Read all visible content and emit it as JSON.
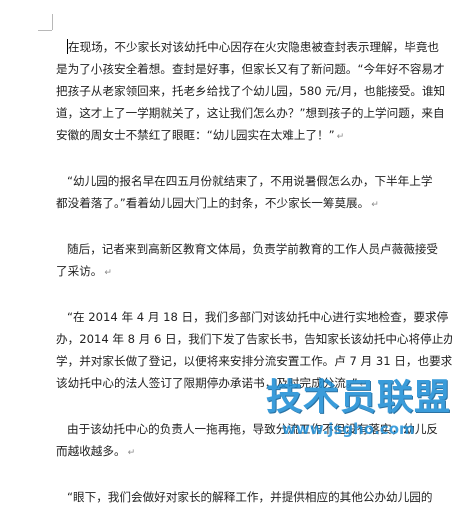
{
  "document": {
    "paragraphs": [
      {
        "lines": [
          "在现场，不少家长对该幼托中心因存在火灾隐患被查封表示理解，毕竟也",
          "是为了小孩安全着想。查封是好事，但家长又有了新问题。“今年好不容易才",
          "把孩子从老家领回来，托老乡给找了个幼儿园，580 元/月，也能接受。谁知",
          "道，这才上了一学期就关了，这让我们怎么办？”想到孩子的上学问题，来自",
          "安徽的周女士不禁红了眼眶：“幼儿园实在太难上了！”"
        ]
      },
      {
        "lines": [
          "“幼儿园的报名早在四五月份就结束了，不用说暑假怎么办，下半年上学",
          "都没着落了。”看着幼儿园大门上的封条，不少家长一筹莫展。"
        ]
      },
      {
        "lines": [
          "随后，记者来到高新区教育文体局，负责学前教育的工作人员卢薇薇接受",
          "了采访。"
        ]
      },
      {
        "lines": [
          "“在 2014 年 4 月 18 日，我们多部门对该幼托中心进行实地检查，要求停",
          "办，2014 年 8 月 6 日，我们下发了告家长书，告知家长该幼托中心将停止办",
          "学，并对家长做了登记，以便将来安排分流安置工作。卢 7 月 31 日，也要求",
          "该幼托中心的法人签订了限期停办承诺书，及时完成分流。”"
        ]
      },
      {
        "lines": [
          "由于该幼托中心的负责人一拖再拖，导致分流工作不但没有落实，幼儿反",
          "而越收越多。"
        ]
      },
      {
        "lines": [
          "“眼下，我们会做好对家长的解释工作，并提供相应的其他公办幼儿园的"
        ]
      }
    ],
    "paragraph_mark": "↵"
  },
  "watermark": {
    "title": "技术员联盟",
    "url": "www.jsgho.com",
    "color": "#1f8fd6"
  }
}
